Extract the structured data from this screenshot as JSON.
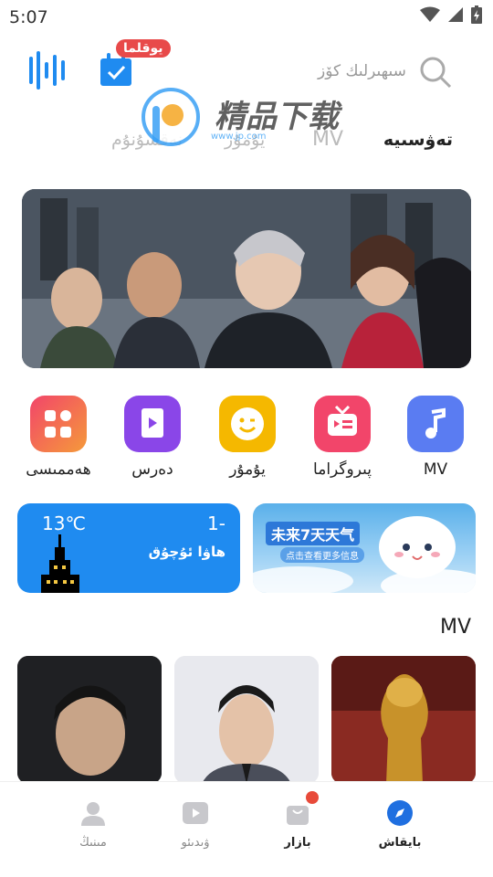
{
  "status_bar": {
    "time": "5:07"
  },
  "header": {
    "checkin_badge": "يوقلما",
    "search_placeholder": "سىھىرلىك كۆز"
  },
  "tabs": [
    {
      "label": "تەۋسىيە"
    },
    {
      "label": "MV"
    },
    {
      "label": "يۇمۇر"
    },
    {
      "label": "نەقسۇنۇم"
    }
  ],
  "watermark": {
    "title": "精品下载",
    "url": "www.jp.com"
  },
  "quick_links": [
    {
      "label": "MV",
      "icon": "music-note-icon",
      "color": "#5a7cf2"
    },
    {
      "label": "پىروگراما",
      "icon": "tv-icon",
      "color": "#f2456a"
    },
    {
      "label": "يۇمۇر",
      "icon": "smile-icon",
      "color": "#f5b800"
    },
    {
      "label": "دەرس",
      "icon": "book-icon",
      "color": "#8a46e8"
    },
    {
      "label": "ھەممىسى",
      "icon": "grid-icon",
      "color": "#f25a6a"
    }
  ],
  "weather": {
    "temp": "13℃",
    "number": "1-",
    "label": "ھاۋا ئۇچۇق"
  },
  "promo": {
    "title": "未来7天天气",
    "subtitle": "点击查看更多信息"
  },
  "section": {
    "title": "MV"
  },
  "bottom_nav": [
    {
      "label": "بايقاش",
      "icon": "compass-icon",
      "active": true
    },
    {
      "label": "بازار",
      "icon": "shopping-bag-icon",
      "active": false
    },
    {
      "label": "ۋىدىئو",
      "icon": "video-play-icon",
      "active": false
    },
    {
      "label": "مىنىڭ",
      "icon": "user-icon",
      "active": false
    }
  ],
  "colors": {
    "accent": "#1f8bf0",
    "badge": "#e84a4a"
  }
}
